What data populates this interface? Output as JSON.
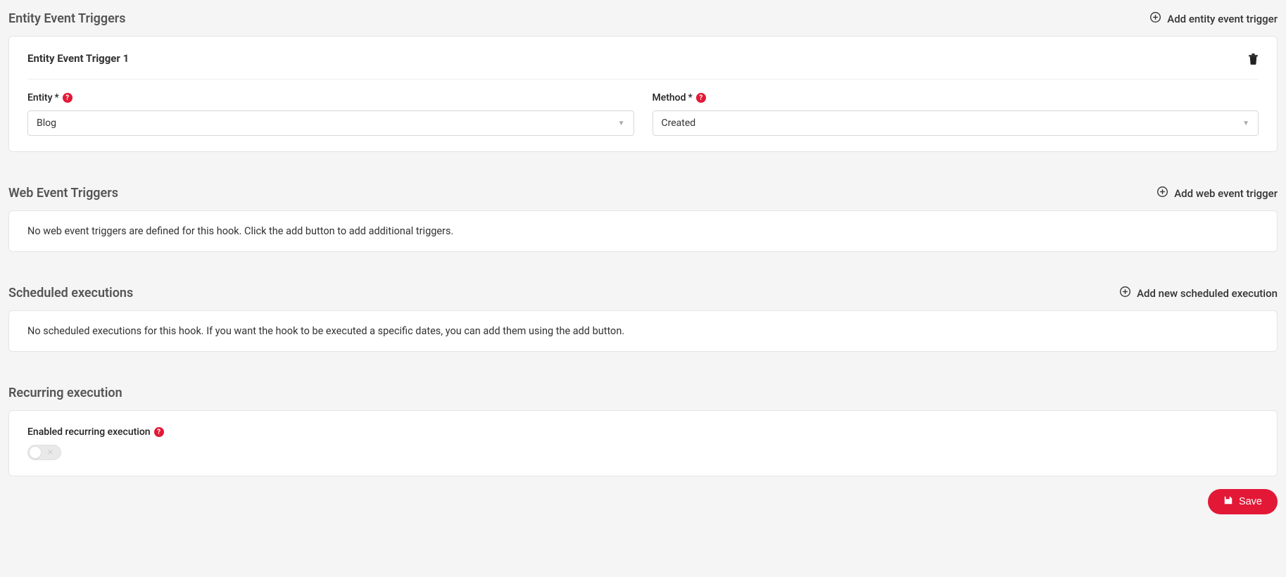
{
  "entity_triggers": {
    "title": "Entity Event Triggers",
    "add_label": "Add entity event trigger",
    "card": {
      "heading": "Entity Event Trigger 1",
      "entity_label": "Entity",
      "entity_value": "Blog",
      "method_label": "Method",
      "method_value": "Created"
    }
  },
  "web_triggers": {
    "title": "Web Event Triggers",
    "add_label": "Add web event trigger",
    "empty": "No web event triggers are defined for this hook. Click the add button to add additional triggers."
  },
  "scheduled": {
    "title": "Scheduled executions",
    "add_label": "Add new scheduled execution",
    "empty": "No scheduled executions for this hook. If you want the hook to be executed a specific dates, you can add them using the add button."
  },
  "recurring": {
    "title": "Recurring execution",
    "toggle_label": "Enabled recurring execution",
    "enabled": false
  },
  "actions": {
    "save": "Save"
  },
  "symbols": {
    "star": "*",
    "help": "?"
  }
}
